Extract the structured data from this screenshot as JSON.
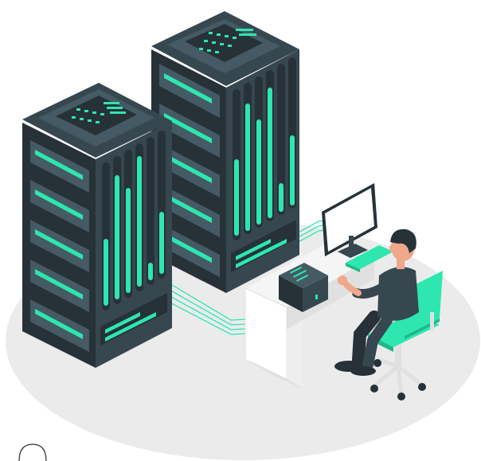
{
  "scene": {
    "subject": "server-room-illustration",
    "icon": "server-rack-icon",
    "colors": {
      "accent": "#2ee6b0",
      "rack_dark": "#263238",
      "rack_mid": "#37474f",
      "rack_light": "#455a64",
      "floor": "#ebebeb",
      "desk": "#f5f5f5",
      "desk_shadow": "#e0e0e0",
      "skin": "#f0a78a",
      "hair": "#263238",
      "shirt": "#37474f",
      "chair": "#2ee6b0"
    }
  }
}
